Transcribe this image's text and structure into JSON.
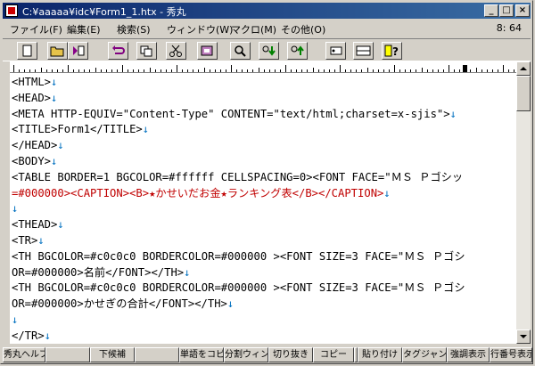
{
  "window": {
    "title": "C:¥aaaaa¥idc¥Form1_1.htx - 秀丸",
    "minimize": "_",
    "maximize": "□",
    "close": "×"
  },
  "menu": {
    "items": [
      "ファイル(F)",
      "編集(E)",
      "検索(S)",
      "ウィンドウ(W)",
      "マクロ(M)",
      "その他(O)"
    ],
    "clock": "8: 64"
  },
  "toolbar": {
    "buttons": [
      "new-file-icon",
      "open-folder-icon",
      "save-icon",
      "undo-icon",
      "copy-icon",
      "cut-icon",
      "paste-icon",
      "search-icon",
      "find-next-icon",
      "find-prev-icon",
      "tag-jump-icon",
      "split-window-icon",
      "help-icon"
    ]
  },
  "editor": {
    "lines": [
      {
        "text": "<HTML>",
        "color": "black"
      },
      {
        "text": "<HEAD>",
        "color": "black"
      },
      {
        "text": "<META HTTP-EQUIV=\"Content-Type\" CONTENT=\"text/html;charset=x-sjis\">",
        "color": "black"
      },
      {
        "text": "<TITLE>Form1</TITLE>",
        "color": "black"
      },
      {
        "text": "</HEAD>",
        "color": "black"
      },
      {
        "text": "<BODY>",
        "color": "black"
      },
      {
        "text": "<TABLE BORDER=1 BGCOLOR=#ffffff CELLSPACING=0><FONT FACE=\"ＭＳ Ｐゴシッ",
        "color": "black",
        "wrap": true
      },
      {
        "text": "=#000000><CAPTION><B>★かせいだお金★ランキング表</B></CAPTION>",
        "color": "red"
      },
      {
        "text": "",
        "color": "black"
      },
      {
        "text": "<THEAD>",
        "color": "black"
      },
      {
        "text": "<TR>",
        "color": "black"
      },
      {
        "text": "<TH BGCOLOR=#c0c0c0 BORDERCOLOR=#000000 ><FONT SIZE=3 FACE=\"ＭＳ Ｐゴシ",
        "color": "black",
        "wrap": true
      },
      {
        "text": "OR=#000000>名前</FONT></TH>",
        "color": "black"
      },
      {
        "text": "<TH BGCOLOR=#c0c0c0 BORDERCOLOR=#000000 ><FONT SIZE=3 FACE=\"ＭＳ Ｐゴシ",
        "color": "black",
        "wrap": true
      },
      {
        "text": "OR=#000000>かせぎの合計</FONT></TH>",
        "color": "black"
      },
      {
        "text": "",
        "color": "black"
      },
      {
        "text": "</TR>",
        "color": "black"
      }
    ],
    "eol_mark": "↓",
    "colors": {
      "red": "#c00000",
      "eol": "#0070c0"
    }
  },
  "statusbar": {
    "keys": [
      "秀丸ヘルプ",
      "",
      "下候補",
      "",
      "単語をコピー",
      "分割ウィンドウ",
      "切り抜き",
      "コピー",
      "",
      "貼り付け",
      "タグジャンプ",
      "強調表示",
      "行番号表示"
    ]
  }
}
